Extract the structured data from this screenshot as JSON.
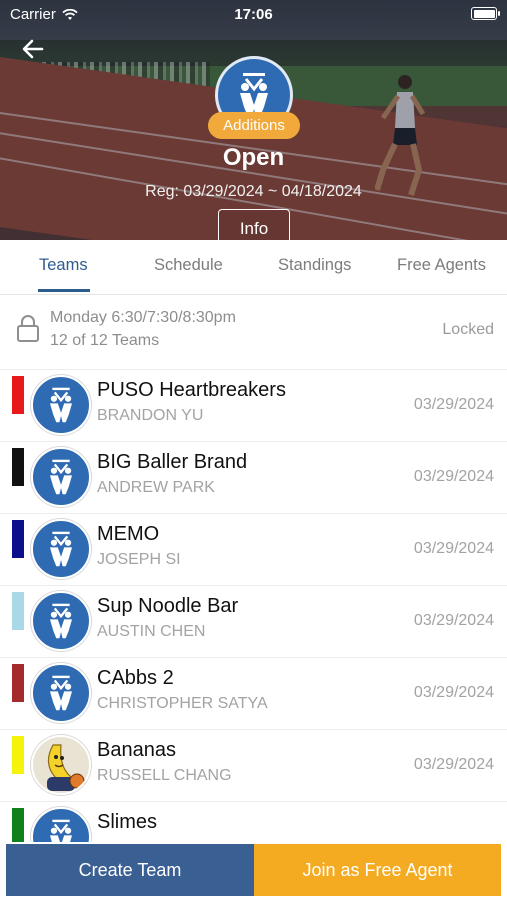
{
  "status_bar": {
    "carrier": "Carrier",
    "time": "17:06"
  },
  "header": {
    "badge": "Additions",
    "division": "Open",
    "registration": "Reg: 03/29/2024 ~ 04/18/2024",
    "info_label": "Info"
  },
  "tabs": [
    {
      "label": "Teams",
      "active": true
    },
    {
      "label": "Schedule",
      "active": false
    },
    {
      "label": "Standings",
      "active": false
    },
    {
      "label": "Free Agents",
      "active": false
    }
  ],
  "schedule": {
    "times": "Monday 6:30/7:30/8:30pm",
    "team_count": "12 of 12 Teams",
    "status": "Locked"
  },
  "teams": [
    {
      "name": "PUSO Heartbreakers",
      "captain": "BRANDON YU",
      "date": "03/29/2024",
      "color": "#e8191b",
      "icon": "league-logo"
    },
    {
      "name": "BIG Baller Brand",
      "captain": "ANDREW PARK",
      "date": "03/29/2024",
      "color": "#111111",
      "icon": "league-logo"
    },
    {
      "name": "MEMO",
      "captain": "JOSEPH SI",
      "date": "03/29/2024",
      "color": "#0b0f8c",
      "icon": "league-logo"
    },
    {
      "name": "Sup Noodle Bar",
      "captain": "AUSTIN CHEN",
      "date": "03/29/2024",
      "color": "#a9d8e6",
      "icon": "league-logo"
    },
    {
      "name": "CAbbs 2",
      "captain": "CHRISTOPHER SATYA",
      "date": "03/29/2024",
      "color": "#a52a2a",
      "icon": "league-logo"
    },
    {
      "name": "Bananas",
      "captain": "RUSSELL CHANG",
      "date": "03/29/2024",
      "color": "#f5f20c",
      "icon": "banana-mascot"
    },
    {
      "name": "Slimes",
      "captain": "",
      "date": "",
      "color": "#10801a",
      "icon": "league-logo"
    }
  ],
  "actions": {
    "create_team": "Create Team",
    "join_free_agent": "Join as Free Agent"
  },
  "colors": {
    "accent": "#2f5c8f",
    "create_button": "#3a5f93",
    "join_button": "#f5ab21",
    "badge": "#f2a93b",
    "logo_blue": "#2f6bb3"
  }
}
